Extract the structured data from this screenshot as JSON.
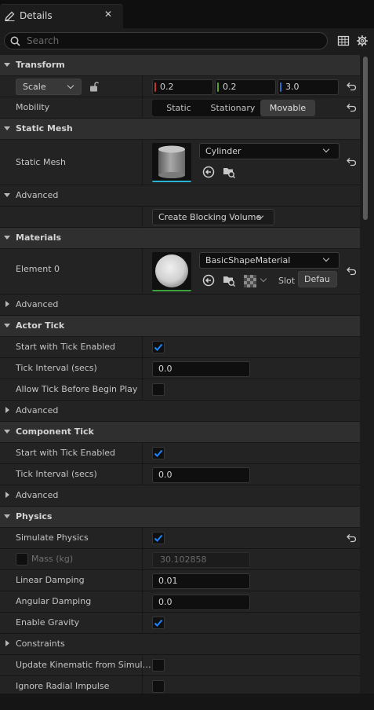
{
  "tab": {
    "title": "Details",
    "close": "✕"
  },
  "search": {
    "placeholder": "Search"
  },
  "transform": {
    "header": "Transform",
    "scale_mode": "Scale",
    "scale_x": "0.2",
    "scale_y": "0.2",
    "scale_z": "3.0",
    "mobility_label": "Mobility",
    "mobility_options": [
      "Static",
      "Stationary",
      "Movable"
    ],
    "mobility_selected": "Movable"
  },
  "static_mesh": {
    "header": "Static Mesh",
    "label": "Static Mesh",
    "mesh_value": "Cylinder",
    "advanced": "Advanced",
    "create_blocking_volume": "Create Blocking Volume"
  },
  "materials": {
    "header": "Materials",
    "element_label": "Element 0",
    "material_value": "BasicShapeMaterial",
    "slot_label": "Slot",
    "slot_value": "Defau",
    "advanced": "Advanced"
  },
  "actor_tick": {
    "header": "Actor Tick",
    "start_label": "Start with Tick Enabled",
    "start_checked": true,
    "interval_label": "Tick Interval (secs)",
    "interval_value": "0.0",
    "allow_before_label": "Allow Tick Before Begin Play",
    "allow_before_checked": false,
    "advanced": "Advanced"
  },
  "component_tick": {
    "header": "Component Tick",
    "start_label": "Start with Tick Enabled",
    "start_checked": true,
    "interval_label": "Tick Interval (secs)",
    "interval_value": "0.0",
    "advanced": "Advanced"
  },
  "physics": {
    "header": "Physics",
    "simulate_label": "Simulate Physics",
    "simulate_checked": true,
    "mass_label": "Mass (kg)",
    "mass_value": "30.102858",
    "linear_label": "Linear Damping",
    "linear_value": "0.01",
    "angular_label": "Angular Damping",
    "angular_value": "0.0",
    "gravity_label": "Enable Gravity",
    "gravity_checked": true,
    "constraints": "Constraints",
    "kinematic_label": "Update Kinematic from Simul…",
    "kinematic_checked": false,
    "radial_label": "Ignore Radial Impulse",
    "radial_checked": false
  },
  "colors": {
    "accent_blue": "#1a85ff",
    "axis_x": "#c83232",
    "axis_y": "#5aa02c",
    "axis_z": "#2c6ecc",
    "mesh_underline": "#28b4d2",
    "material_underline": "#3ca03c"
  },
  "icons": [
    "edit-pencil-icon",
    "close-icon",
    "search-icon",
    "table-view-icon",
    "gear-icon",
    "lock-icon",
    "reset-arrow-icon",
    "use-selected-icon",
    "browse-folder-icon",
    "checkerboard-icon",
    "chevron-down-icon",
    "checkmark-icon"
  ]
}
